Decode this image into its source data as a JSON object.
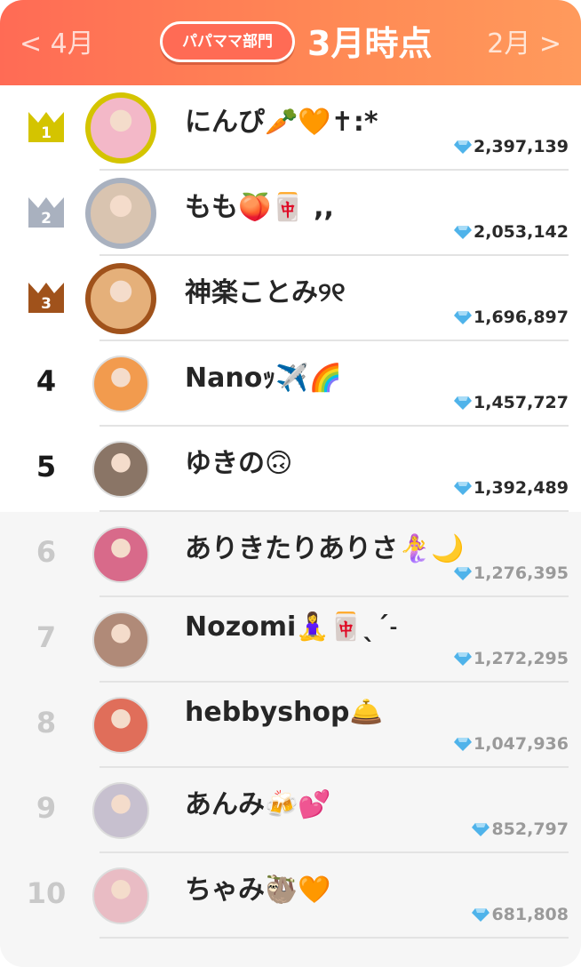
{
  "header": {
    "prev_label": "< 4月",
    "next_label": "2月 >",
    "category_label": "パパママ部門",
    "period_label": "3月時点"
  },
  "colors": {
    "header_gradient_start": "#ff6b55",
    "header_gradient_end": "#ff9a5c",
    "gold": "#d4c400",
    "silver": "#a9b1bf",
    "bronze": "#a0521b",
    "gem": "#4fb3ea"
  },
  "ranking": [
    {
      "rank": "1",
      "name": "にんぴ🥕🧡✝︎:*",
      "score": "2,397,139",
      "medal": "gold",
      "avatar_color": "#f3b8c8"
    },
    {
      "rank": "2",
      "name": "もも🍑🀄 ,,",
      "score": "2,053,142",
      "medal": "silver",
      "avatar_color": "#d9c4b0"
    },
    {
      "rank": "3",
      "name": "神楽ことみ୨୧",
      "score": "1,696,897",
      "medal": "bronze",
      "avatar_color": "#e5b07a"
    },
    {
      "rank": "4",
      "name": "Nanoｯ✈️🌈",
      "score": "1,457,727",
      "medal": "",
      "avatar_color": "#f29b4e"
    },
    {
      "rank": "5",
      "name": "ゆきの🙃",
      "score": "1,392,489",
      "medal": "",
      "avatar_color": "#8a7566"
    },
    {
      "rank": "6",
      "name": "ありきたりありさ🧜‍♀️🌙",
      "score": "1,276,395",
      "medal": "",
      "avatar_color": "#d86a8a"
    },
    {
      "rank": "7",
      "name": "Nozomi🧘‍♀️🀄ˎˊ˗",
      "score": "1,272,295",
      "medal": "",
      "avatar_color": "#b08a78"
    },
    {
      "rank": "8",
      "name": "hebbyshop🛎️",
      "score": "1,047,936",
      "medal": "",
      "avatar_color": "#e06e5a"
    },
    {
      "rank": "9",
      "name": "あんみ🍻💕",
      "score": "852,797",
      "medal": "",
      "avatar_color": "#c7c0cf"
    },
    {
      "rank": "10",
      "name": "ちゃみ🦥🧡",
      "score": "681,808",
      "medal": "",
      "avatar_color": "#e9bcc4"
    }
  ]
}
